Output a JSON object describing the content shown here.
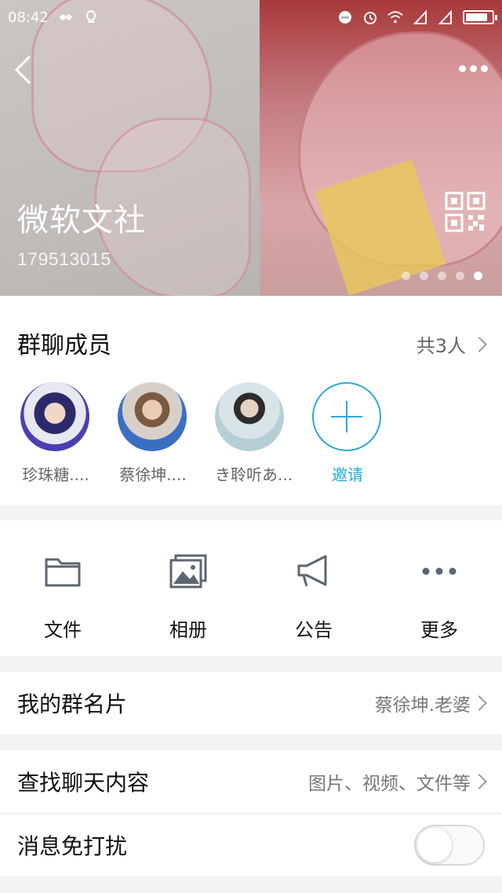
{
  "status_bar": {
    "time": "08:42",
    "battery_level": 0.85
  },
  "header": {
    "group_name": "微软文社",
    "group_id": "179513015",
    "page_dots_count": 5,
    "active_dot": 5
  },
  "members": {
    "title": "群聊成员",
    "count": "共3人",
    "list": [
      {
        "name": "珍珠糖...."
      },
      {
        "name": "蔡徐坤...."
      },
      {
        "name": "き聆听あ..."
      }
    ],
    "invite_label": "邀请"
  },
  "actions": [
    {
      "label": "文件",
      "icon": "folder-icon"
    },
    {
      "label": "相册",
      "icon": "album-icon"
    },
    {
      "label": "公告",
      "icon": "megaphone-icon"
    },
    {
      "label": "更多",
      "icon": "more-dots-icon"
    }
  ],
  "settings": {
    "card_nickname": {
      "title": "我的群名片",
      "value": "蔡徐坤.老婆"
    },
    "search_history": {
      "title": "查找聊天内容",
      "value": "图片、视频、文件等"
    },
    "do_not_disturb": {
      "title": "消息免打扰",
      "enabled": false
    }
  },
  "colors": {
    "accent": "#28a9d9",
    "background": "#f2f3f5"
  }
}
